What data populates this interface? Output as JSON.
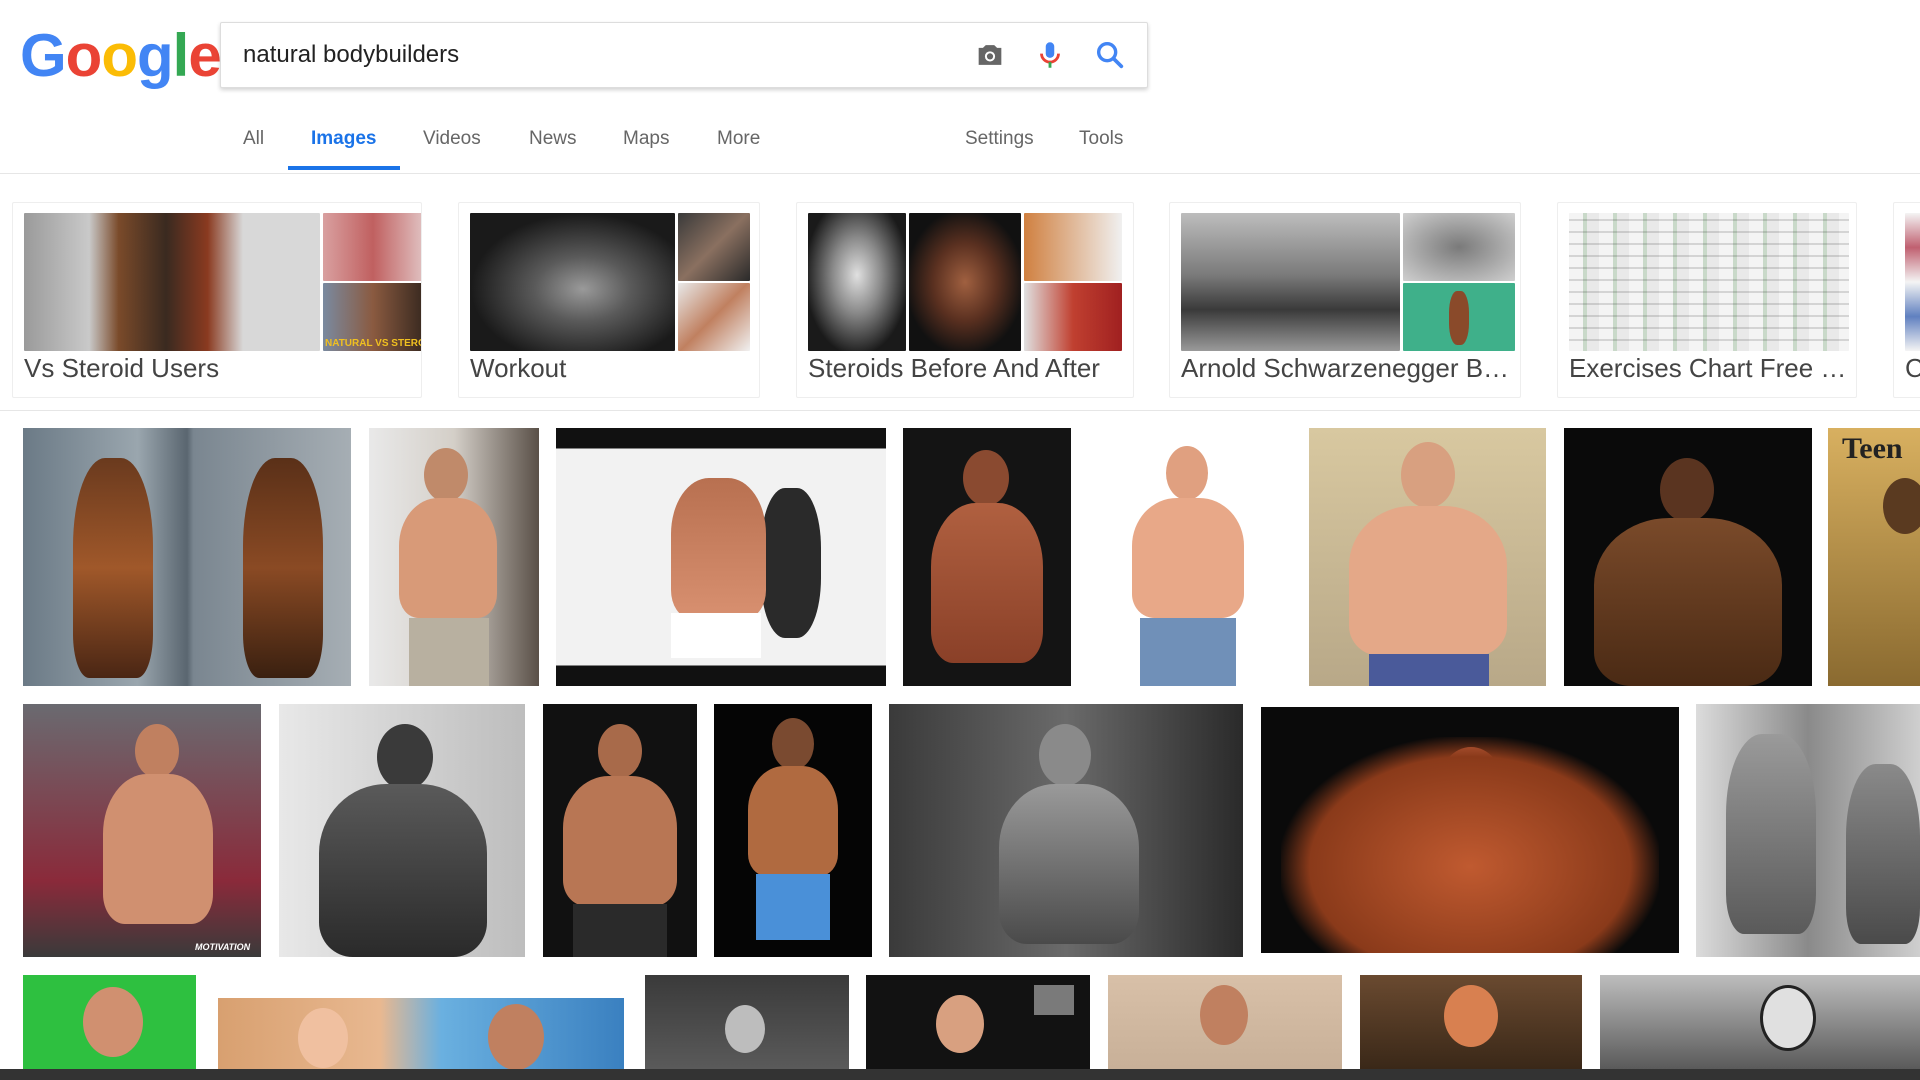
{
  "logo": {
    "letters": [
      "G",
      "o",
      "o",
      "g",
      "l",
      "e"
    ],
    "colors": [
      "#4285F4",
      "#EA4335",
      "#FBBC05",
      "#4285F4",
      "#34A853",
      "#EA4335"
    ]
  },
  "search": {
    "query": "natural bodybuilders",
    "camera_icon": "camera-icon",
    "mic_icon": "microphone-icon",
    "search_icon": "search-icon"
  },
  "tabs": {
    "all": "All",
    "images": "Images",
    "videos": "Videos",
    "news": "News",
    "maps": "Maps",
    "more": "More",
    "settings": "Settings",
    "tools": "Tools"
  },
  "accent_color": "#1a73e8",
  "suggestions": [
    {
      "label": "Vs Steroid Users"
    },
    {
      "label": "Workout"
    },
    {
      "label": "Steroids Before And After"
    },
    {
      "label": "Arnold Schwarzenegger B…"
    },
    {
      "label": "Exercises Chart Free …"
    },
    {
      "label": "C"
    }
  ],
  "thumb_text": {
    "natural_vs_steroid": "NATURAL VS STEROID",
    "teen": "Teen",
    "motivation": "MOTIVATION"
  }
}
